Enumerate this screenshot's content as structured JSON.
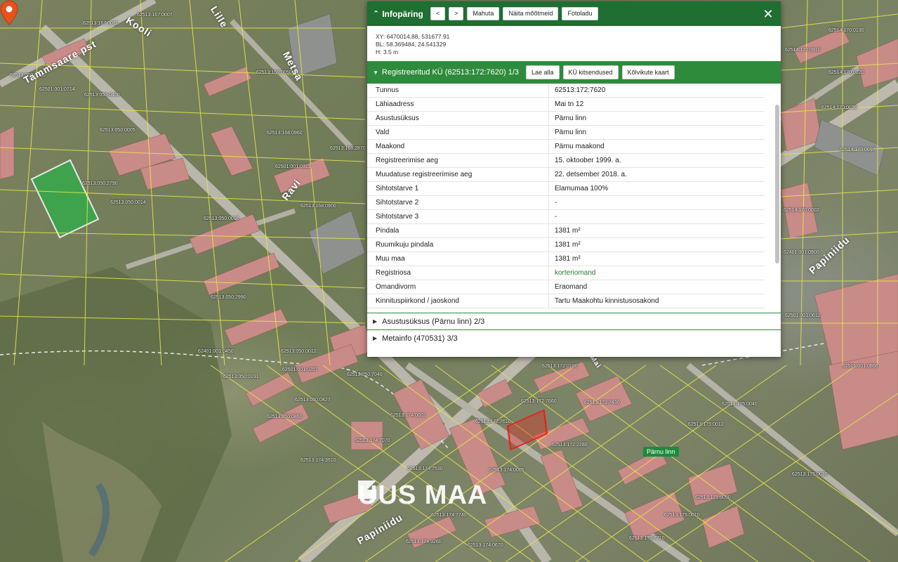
{
  "panel": {
    "title": "Infopäring",
    "buttons": {
      "prev": "<",
      "next": ">",
      "fit": "Mahuta",
      "measure": "Näita mõõtmeid",
      "photos": "Fotoladu"
    },
    "close": "✕",
    "coords": {
      "xy": "XY: 6470014.88, 531677.91",
      "bl": "BL: 58.369484, 24.541329",
      "h": "H: 3.5 m"
    },
    "section": {
      "title": "Registreeritud KÜ (62513:172:7620) 1/3",
      "buttons": {
        "download": "Lae alla",
        "restrictions": "KÜ kitsendused",
        "utilities": "Kõlvikute kaart"
      }
    },
    "properties": [
      {
        "key": "Tunnus",
        "value": "62513:172:7620"
      },
      {
        "key": "Lähiaadress",
        "value": "Mai tn 12"
      },
      {
        "key": "Asustusüksus",
        "value": "Pärnu linn"
      },
      {
        "key": "Vald",
        "value": "Pärnu linn"
      },
      {
        "key": "Maakond",
        "value": "Pärnu maakond"
      },
      {
        "key": "Registreerimise aeg",
        "value": "15. oktoober 1999. a."
      },
      {
        "key": "Muudatuse registreerimise aeg",
        "value": "22. detsember 2018. a."
      },
      {
        "key": "Sihtotstarve 1",
        "value": "Elamumaa 100%"
      },
      {
        "key": "Sihtotstarve 2",
        "value": "-"
      },
      {
        "key": "Sihtotstarve 3",
        "value": "-"
      },
      {
        "key": "Pindala",
        "value": "1381 m²"
      },
      {
        "key": "Ruumikuju pindala",
        "value": "1381 m²"
      },
      {
        "key": "Muu maa",
        "value": "1381 m²"
      },
      {
        "key": "Registriosa",
        "value": "korteriomand"
      },
      {
        "key": "Omandivorm",
        "value": "Eraomand"
      },
      {
        "key": "Kinnituspiirkond / jaoskond",
        "value": "Tartu Maakohtu kinnistusosakond"
      }
    ],
    "collapsed_sections": [
      {
        "label": "Asustusüksus (Pärnu linn) 2/3"
      },
      {
        "label": "Metainfo (470531) 3/3"
      }
    ]
  },
  "map": {
    "watermark": "UUS MAA",
    "marker_label": "Pärnu linn",
    "streets": [
      "Tammsaare pst",
      "Kooli",
      "Lille",
      "Metsa",
      "Ravi",
      "Papiniidu",
      "Mai"
    ],
    "parcel_labels": [
      "62513:167:0007",
      "62513:167:0071",
      "62513:168:0050",
      "62513:050:0680",
      "62501:001:0714",
      "62513:050:0400",
      "62513:050:0005",
      "62513:168:2870",
      "62501:001:0323",
      "62513:050:2790",
      "62513:050:0014",
      "62513:168:0960",
      "62513:168:0900",
      "62513:050:0010",
      "62513:050:0012",
      "62513:050:2990",
      "62401:001:0450",
      "62513:050:0191",
      "62501:001:0257",
      "62513:050:7040",
      "62513:050:0860",
      "62513:050:0427",
      "62513:174:0002",
      "62513:174:7070",
      "62513:174:3510",
      "62513:174:7530",
      "62513:174:0005",
      "62513:174:7740",
      "62513:174:0670",
      "62513:174:9260",
      "62514:170:0130",
      "62514:170:0910",
      "62514:170:0120",
      "62514:170:0030",
      "62514:170:0017",
      "62514:170:0002",
      "62401:001:0900",
      "62501:001:0612",
      "62501:001:0866",
      "62513:172:0180",
      "62513:172:7660",
      "62513:172:7430",
      "62513:172:7610",
      "62513:172:2280",
      "62513:175:0040",
      "62513:175:0012",
      "62513:175:8090",
      "62513:175:0030",
      "62513:175:0010",
      "62513:175:7710"
    ]
  }
}
